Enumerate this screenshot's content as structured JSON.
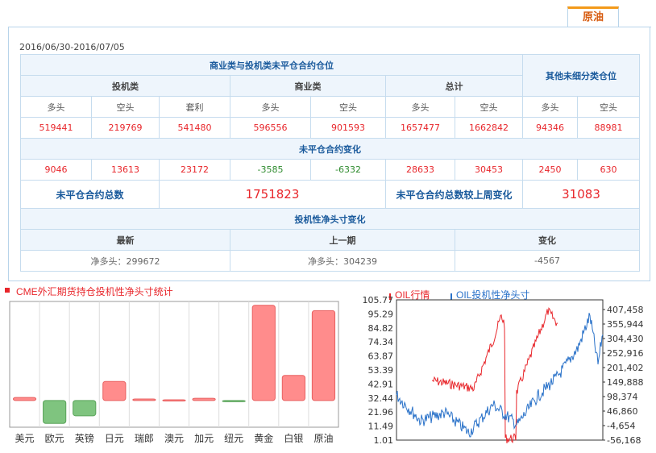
{
  "tab": {
    "label": "原油"
  },
  "date_range": "2016/06/30-2016/07/05",
  "table": {
    "header_main": "商业类与投机类未平仓合约仓位",
    "header_other": "其他未细分类仓位",
    "groups": {
      "spec": "投机类",
      "comm": "商业类",
      "total": "总计"
    },
    "cols": {
      "long": "多头",
      "short": "空头",
      "spread": "套利"
    },
    "positions": [
      "519441",
      "219769",
      "541480",
      "596556",
      "901593",
      "1657477",
      "1662842",
      "94346",
      "88981"
    ],
    "change_header": "未平仓合约变化",
    "changes": [
      "9046",
      "13613",
      "23172",
      "-3585",
      "-6332",
      "28633",
      "30453",
      "2450",
      "630"
    ],
    "total_label": "未平仓合约总数",
    "total_value": "1751823",
    "weekly_change_label": "未平仓合约总数较上周变化",
    "weekly_change_value": "31083",
    "net_header": "投机性净头寸变化",
    "net_cols": {
      "latest": "最新",
      "prev": "上一期",
      "change": "变化"
    },
    "net_values": {
      "latest": "净多头：299672",
      "prev": "净多头：304239",
      "change": "-4567"
    }
  },
  "colors": {
    "red": "#e8262b",
    "green": "#2e8b2e",
    "blue": "#1a5a9c",
    "accent": "#f39a1a"
  },
  "chart_data": [
    {
      "type": "bar",
      "title": "CME外汇期货持仓投机性净头寸统计",
      "categories": [
        "美元",
        "欧元",
        "英镑",
        "日元",
        "瑞郎",
        "澳元",
        "加元",
        "纽元",
        "黄金",
        "白银",
        "原油"
      ],
      "values": [
        4,
        -30,
        -20,
        25,
        2,
        1,
        3,
        -1,
        125,
        33,
        118
      ],
      "ylim": [
        -35,
        130
      ],
      "grid": true
    },
    {
      "type": "line",
      "series": [
        {
          "name": "OIL行情",
          "color": "#e8262b"
        },
        {
          "name": "OIL投机性净头寸",
          "color": "#2a72c9"
        }
      ],
      "y_left_ticks": [
        "105.77",
        "95.29",
        "84.82",
        "74.34",
        "63.87",
        "53.39",
        "42.91",
        "32.44",
        "21.96",
        "11.49",
        "1.01"
      ],
      "y_right_ticks": [
        "407,458",
        "355,944",
        "304,430",
        "252,916",
        "201,402",
        "149,888",
        "98,374",
        "46,860",
        "-4,654",
        "-56,168"
      ]
    }
  ]
}
